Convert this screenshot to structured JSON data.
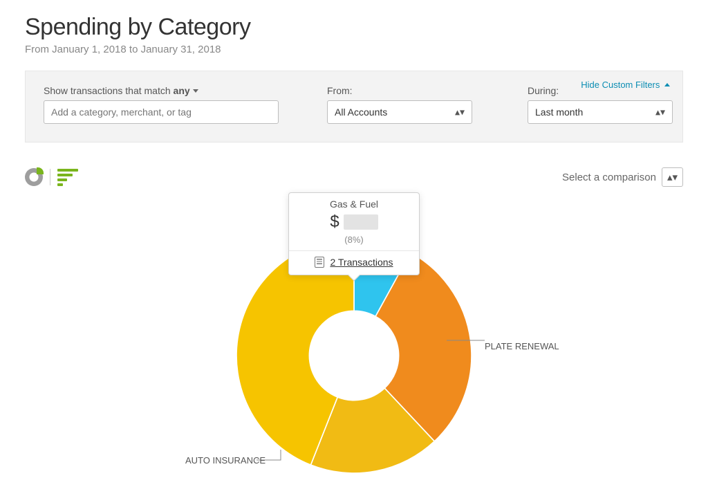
{
  "header": {
    "title": "Spending by Category",
    "subtitle": "From January 1, 2018 to January 31, 2018"
  },
  "filters": {
    "hide_link": "Hide Custom Filters",
    "match_prefix": "Show transactions that match",
    "match_mode": "any",
    "search_placeholder": "Add a category, merchant, or tag",
    "from_label": "From:",
    "from_value": "All Accounts",
    "during_label": "During:",
    "during_value": "Last month"
  },
  "compare": {
    "label": "Select a comparison"
  },
  "tooltip": {
    "category": "Gas & Fuel",
    "amount_prefix": "$",
    "percent": "(8%)",
    "transactions_text": "2  Transactions"
  },
  "labels": {
    "plate": "PLATE RENEWAL",
    "auto": "AUTO INSURANCE"
  },
  "chart_data": {
    "type": "pie",
    "title": "Spending by Category",
    "series": [
      {
        "name": "Gas & Fuel",
        "percent": 8,
        "color": "#2fc4ee"
      },
      {
        "name": "PLATE RENEWAL",
        "percent": 30,
        "color": "#f08b1d"
      },
      {
        "name": "(unlabeled)",
        "percent": 18,
        "color": "#f1bb14"
      },
      {
        "name": "AUTO INSURANCE",
        "percent": 44,
        "color": "#f6c400"
      }
    ],
    "inner_radius_ratio": 0.38
  }
}
